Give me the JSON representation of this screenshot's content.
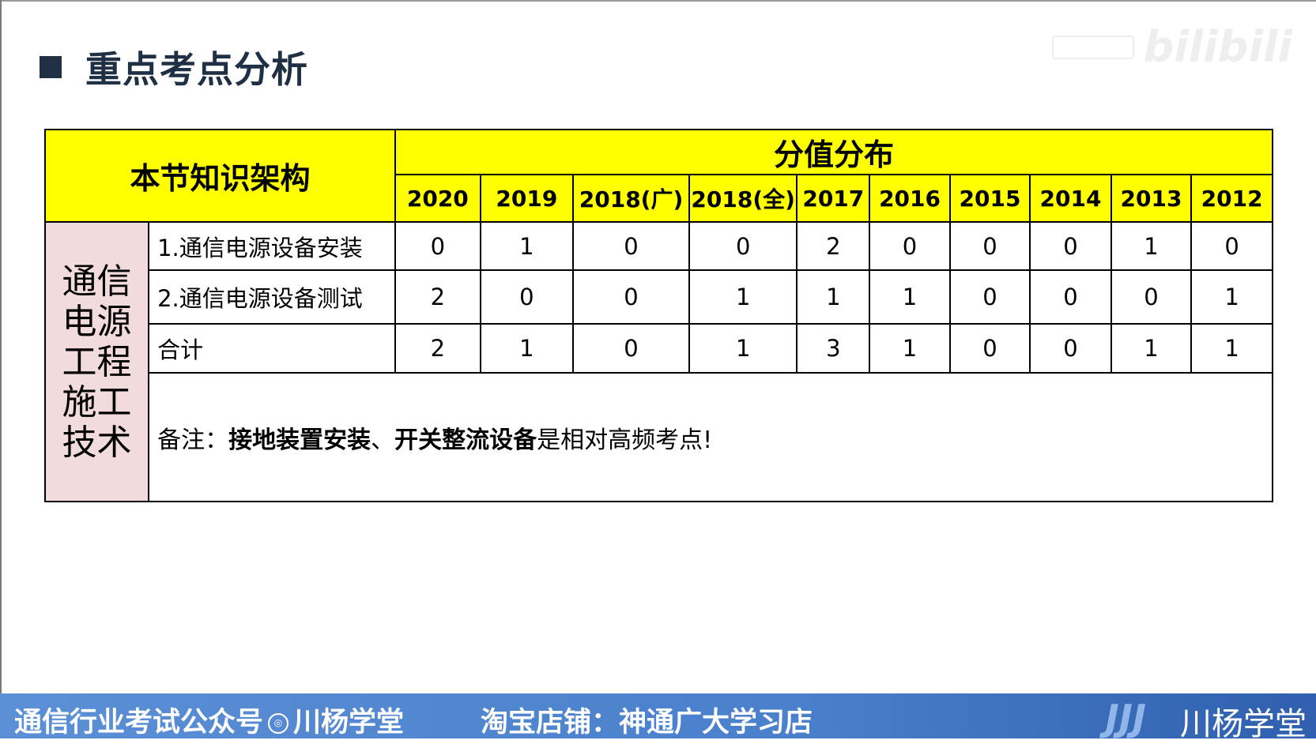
{
  "title": "重点考点分析",
  "watermark": "bilibili",
  "table": {
    "header_left": "本节知识架构",
    "header_right": "分值分布",
    "years": [
      "2020",
      "2019",
      "2018(广)",
      "2018(全)",
      "2017",
      "2016",
      "2015",
      "2014",
      "2013",
      "2012"
    ],
    "side_label": [
      "通信",
      "电源",
      "工程",
      "施工",
      "技术"
    ],
    "rows": [
      {
        "label": "1.通信电源设备安装",
        "values": [
          "0",
          "1",
          "0",
          "0",
          "2",
          "0",
          "0",
          "0",
          "1",
          "0"
        ]
      },
      {
        "label": "2.通信电源设备测试",
        "values": [
          "2",
          "0",
          "0",
          "1",
          "1",
          "1",
          "0",
          "0",
          "0",
          "1"
        ]
      },
      {
        "label": "合计",
        "values": [
          "2",
          "1",
          "0",
          "1",
          "3",
          "1",
          "0",
          "0",
          "1",
          "1"
        ]
      }
    ],
    "note": {
      "prefix": "备注：",
      "bold1": "接地装置安装",
      "sep": "、",
      "bold2": "开关整流设备",
      "suffix": "是相对高频考点!"
    }
  },
  "footer": {
    "left_a": "通信行业考试公众号",
    "left_b": "川杨学堂",
    "middle": "淘宝店铺：神通广大学习店",
    "logo_text": "川杨学堂"
  },
  "colors": {
    "header_yellow": "#ffff00",
    "side_pink": "#f2dbdc",
    "title_dark": "#1f3044",
    "footer_blue": "#4a80cc"
  }
}
